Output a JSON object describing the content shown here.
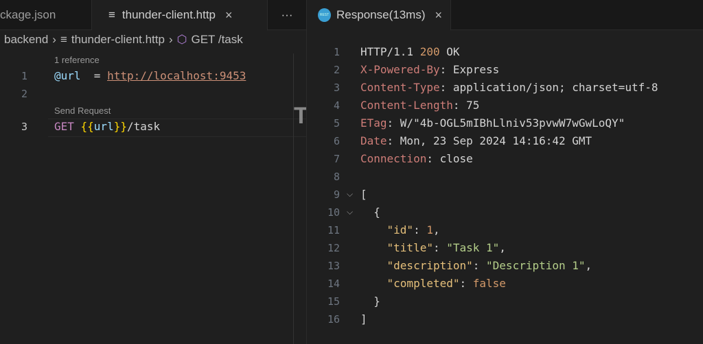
{
  "left_tabs": [
    {
      "label": "ckage.json"
    },
    {
      "label": "thunder-client.http",
      "close": "×"
    }
  ],
  "more_label": "···",
  "breadcrumb": {
    "folder": "backend",
    "file": "thunder-client.http",
    "symbol": "GET /task"
  },
  "editor": {
    "codelens_reference": "1 reference",
    "codelens_send": "Send Request",
    "lines": [
      {
        "n": "1",
        "tokens": [
          [
            "b",
            "@url"
          ],
          [
            "",
            "  = "
          ],
          [
            "u",
            "http://localhost:9453"
          ]
        ]
      },
      {
        "n": "2",
        "tokens": []
      },
      {
        "n": "3",
        "tokens": [
          [
            "p",
            "GET "
          ],
          [
            "y",
            "{{"
          ],
          [
            "b",
            "url"
          ],
          [
            "y",
            "}}"
          ],
          [
            "",
            "/task"
          ]
        ]
      }
    ],
    "minimap_glyph": "T"
  },
  "response_tab": {
    "label": "Response(13ms)",
    "close": "×",
    "icon": "rest-client-icon"
  },
  "response": {
    "lines": [
      {
        "n": "1",
        "tokens": [
          [
            "",
            "HTTP/1.1 "
          ],
          [
            "n",
            "200"
          ],
          [
            "",
            " OK"
          ]
        ]
      },
      {
        "n": "2",
        "tokens": [
          [
            "k",
            "X-Powered-By"
          ],
          [
            "",
            ": Express"
          ]
        ]
      },
      {
        "n": "3",
        "tokens": [
          [
            "k",
            "Content-Type"
          ],
          [
            "",
            ": application/json; charset=utf-8"
          ]
        ]
      },
      {
        "n": "4",
        "tokens": [
          [
            "k",
            "Content-Length"
          ],
          [
            "",
            ": 75"
          ]
        ]
      },
      {
        "n": "5",
        "tokens": [
          [
            "k",
            "ETag"
          ],
          [
            "",
            ": W/\"4b-OGL5mIBhLlniv53pvwW7wGwLoQY\""
          ]
        ]
      },
      {
        "n": "6",
        "tokens": [
          [
            "k",
            "Date"
          ],
          [
            "",
            ": Mon, 23 Sep 2024 14:16:42 GMT"
          ]
        ]
      },
      {
        "n": "7",
        "tokens": [
          [
            "k",
            "Connection"
          ],
          [
            "",
            ": close"
          ]
        ]
      },
      {
        "n": "8",
        "tokens": []
      },
      {
        "n": "9",
        "fold": true,
        "tokens": [
          [
            "",
            "["
          ]
        ]
      },
      {
        "n": "10",
        "fold": true,
        "tokens": [
          [
            "",
            "  {"
          ]
        ]
      },
      {
        "n": "11",
        "tokens": [
          [
            "",
            "    "
          ],
          [
            "jk",
            "\"id\""
          ],
          [
            "",
            ": "
          ],
          [
            "n",
            "1"
          ],
          [
            "",
            ","
          ]
        ]
      },
      {
        "n": "12",
        "tokens": [
          [
            "",
            "    "
          ],
          [
            "jk",
            "\"title\""
          ],
          [
            "",
            ": "
          ],
          [
            "jv",
            "\"Task 1\""
          ],
          [
            "",
            ","
          ]
        ]
      },
      {
        "n": "13",
        "tokens": [
          [
            "",
            "    "
          ],
          [
            "jk",
            "\"description\""
          ],
          [
            "",
            ": "
          ],
          [
            "jv",
            "\"Description 1\""
          ],
          [
            "",
            ","
          ]
        ]
      },
      {
        "n": "14",
        "tokens": [
          [
            "",
            "    "
          ],
          [
            "jk",
            "\"completed\""
          ],
          [
            "",
            ": "
          ],
          [
            "n",
            "false"
          ]
        ]
      },
      {
        "n": "15",
        "tokens": [
          [
            "",
            "  }"
          ]
        ]
      },
      {
        "n": "16",
        "tokens": [
          [
            "",
            "]"
          ]
        ]
      }
    ]
  }
}
